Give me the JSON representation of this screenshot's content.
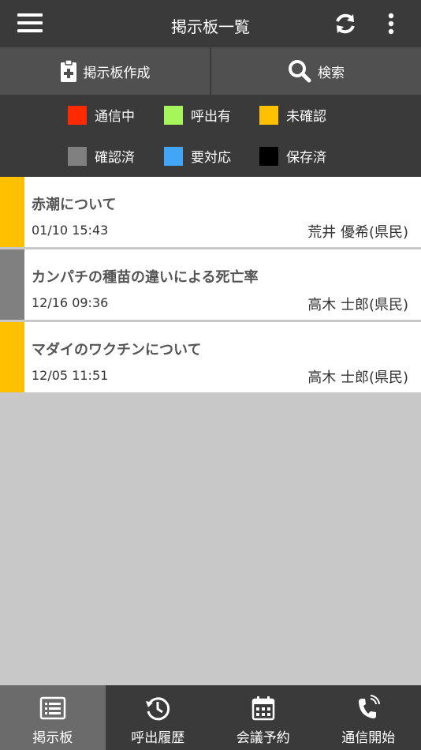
{
  "header": {
    "title": "掲示板一覧"
  },
  "actions": {
    "create_label": "掲示板作成",
    "search_label": "検索"
  },
  "legend": [
    {
      "label": "通信中",
      "color": "#ff2a00"
    },
    {
      "label": "呼出有",
      "color": "#a6f55a"
    },
    {
      "label": "未確認",
      "color": "#ffc000"
    },
    {
      "label": "確認済",
      "color": "#808080"
    },
    {
      "label": "要対応",
      "color": "#42a5f5"
    },
    {
      "label": "保存済",
      "color": "#000000"
    }
  ],
  "posts": [
    {
      "title": "赤潮について",
      "date": "01/10 15:43",
      "author": "荒井 優希(県民)",
      "status_color": "#ffc000"
    },
    {
      "title": "カンパチの種苗の違いによる死亡率",
      "date": "12/16 09:36",
      "author": "高木 士郎(県民)",
      "status_color": "#808080"
    },
    {
      "title": "マダイのワクチンについて",
      "date": "12/05 11:51",
      "author": "高木 士郎(県民)",
      "status_color": "#ffc000"
    }
  ],
  "nav": [
    {
      "label": "掲示板",
      "icon": "list-icon"
    },
    {
      "label": "呼出履歴",
      "icon": "history-icon"
    },
    {
      "label": "会議予約",
      "icon": "calendar-icon"
    },
    {
      "label": "通信開始",
      "icon": "phone-ring-icon"
    }
  ]
}
